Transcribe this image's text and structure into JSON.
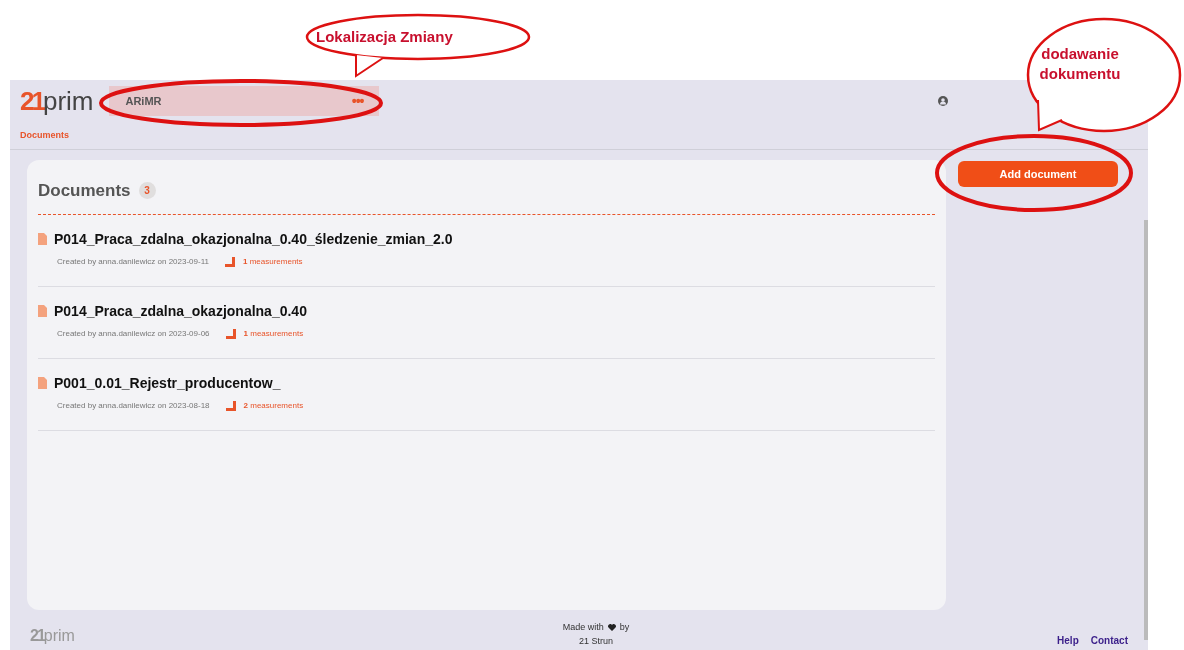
{
  "header": {
    "logo": {
      "mark": "21",
      "word": "prim"
    },
    "location": "ARiMR",
    "menu": "•••"
  },
  "breadcrumb": "Documents",
  "panel": {
    "title": "Documents",
    "count": "3",
    "documents": [
      {
        "name": "P014_Praca_zdalna_okazjonalna_0.40_śledzenie_zmian_2.0",
        "created": "Created by anna.danilewicz on 2023-09-11",
        "count": "1",
        "measurements": "measurements"
      },
      {
        "name": "P014_Praca_zdalna_okazjonalna_0.40",
        "created": "Created by anna.danilewicz on 2023-09-06",
        "count": "1",
        "measurements": "measurements"
      },
      {
        "name": "P001_0.01_Rejestr_producentow_",
        "created": "Created by anna.danilewicz on 2023-08-18",
        "count": "2",
        "measurements": "measurements"
      }
    ]
  },
  "add_button": "Add document",
  "footer": {
    "logo": {
      "mark": "21",
      "word": "prim"
    },
    "made_with": "Made with",
    "by": "by",
    "company": "21 Strun",
    "links": [
      "Help",
      "Contact"
    ]
  },
  "annotations": [
    {
      "text": "Lokalizacja Zmiany"
    },
    {
      "text": "dodawanie dokumentu"
    }
  ]
}
